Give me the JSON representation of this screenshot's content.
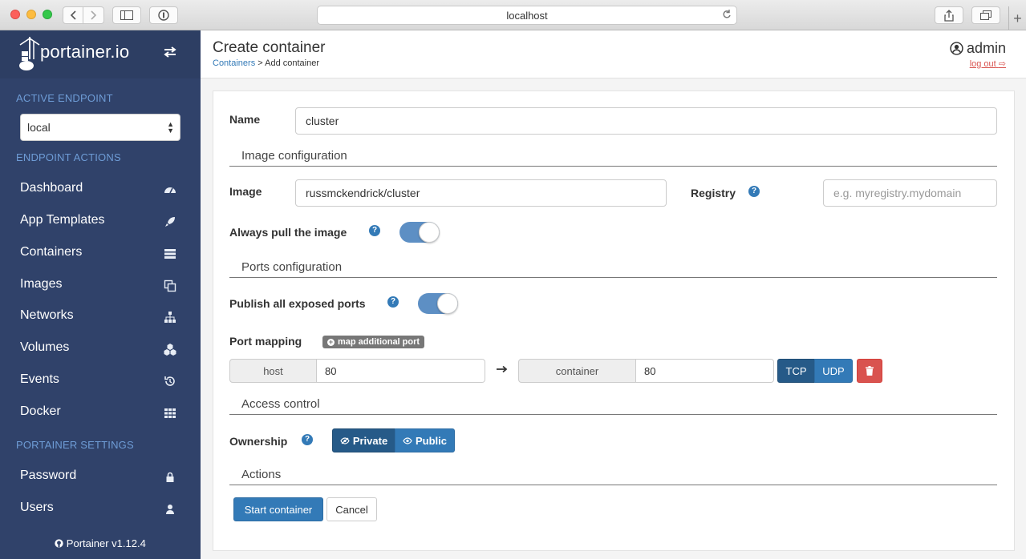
{
  "browser": {
    "url": "localhost"
  },
  "sidebar": {
    "brand": "portainer.io",
    "active_endpoint_heading": "ACTIVE ENDPOINT",
    "endpoint_value": "local",
    "endpoint_actions_heading": "ENDPOINT ACTIONS",
    "items": [
      {
        "label": "Dashboard",
        "icon": "dashboard-icon"
      },
      {
        "label": "App Templates",
        "icon": "rocket-icon"
      },
      {
        "label": "Containers",
        "icon": "server-icon"
      },
      {
        "label": "Images",
        "icon": "clone-icon"
      },
      {
        "label": "Networks",
        "icon": "sitemap-icon"
      },
      {
        "label": "Volumes",
        "icon": "cubes-icon"
      },
      {
        "label": "Events",
        "icon": "history-icon"
      },
      {
        "label": "Docker",
        "icon": "th-icon"
      }
    ],
    "settings_heading": "PORTAINER SETTINGS",
    "settings_items": [
      {
        "label": "Password",
        "icon": "lock-icon"
      },
      {
        "label": "Users",
        "icon": "user-icon"
      }
    ],
    "version": "Portainer v1.12.4"
  },
  "header": {
    "title": "Create container",
    "breadcrumb_link": "Containers",
    "breadcrumb_current": "> Add container",
    "username": "admin",
    "logout": "log out"
  },
  "form": {
    "name_label": "Name",
    "name_value": "cluster",
    "image_section": "Image configuration",
    "image_label": "Image",
    "image_value": "russmckendrick/cluster",
    "registry_label": "Registry",
    "registry_placeholder": "e.g. myregistry.mydomain",
    "always_pull_label": "Always pull the image",
    "always_pull_on": true,
    "ports_section": "Ports configuration",
    "publish_all_label": "Publish all exposed ports",
    "publish_all_on": true,
    "port_mapping_label": "Port mapping",
    "map_additional_port": "map additional port",
    "host_addon": "host",
    "host_port": "80",
    "container_addon": "container",
    "container_port": "80",
    "tcp": "TCP",
    "udp": "UDP",
    "access_section": "Access control",
    "ownership_label": "Ownership",
    "private": "Private",
    "public": "Public",
    "actions_section": "Actions",
    "start": "Start container",
    "cancel": "Cancel"
  },
  "colors": {
    "sidebar_bg": "#30426a",
    "primary": "#337ab7",
    "primary_dark": "#265a88",
    "danger": "#d9534f"
  }
}
